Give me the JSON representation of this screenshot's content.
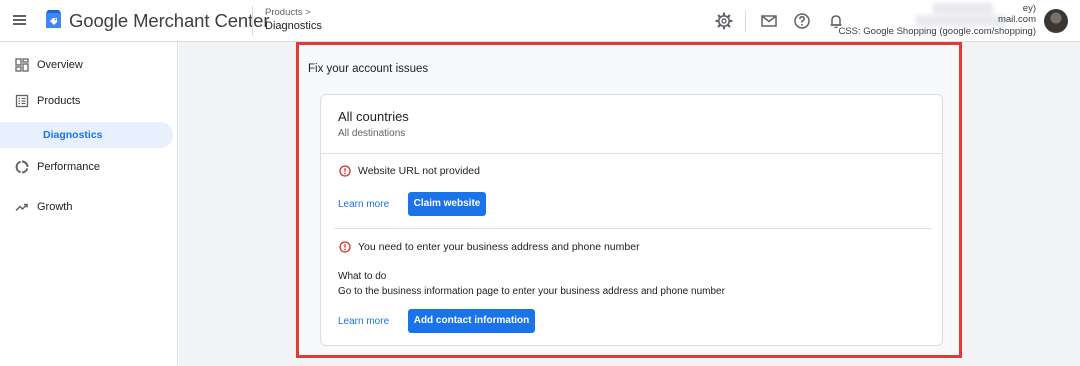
{
  "header": {
    "app_name": "Google Merchant Center",
    "breadcrumb_parent": "Products >",
    "breadcrumb_current": "Diagnostics",
    "account_name_suffix": "ey)",
    "account_email_suffix": "mail.com",
    "account_css": "CSS: Google Shopping (google.com/shopping)"
  },
  "sidebar": {
    "items": [
      {
        "label": "Overview",
        "icon": "dashboard-icon"
      },
      {
        "label": "Products",
        "icon": "list-icon"
      },
      {
        "label": "Diagnostics",
        "icon": ""
      },
      {
        "label": "Performance",
        "icon": "donut-chart-icon"
      },
      {
        "label": "Growth",
        "icon": "trending-up-icon"
      }
    ]
  },
  "main": {
    "panel_title": "Fix your account issues",
    "card": {
      "title": "All countries",
      "subtitle": "All destinations",
      "issues": [
        {
          "text": "Website URL not provided",
          "learn_more": "Learn more",
          "action": "Claim website"
        },
        {
          "text": "You need to enter your business address and phone number",
          "what_to_do_label": "What to do",
          "what_to_do_text": "Go to the business information page to enter your business address and phone number",
          "learn_more": "Learn more",
          "action": "Add contact information"
        }
      ]
    }
  },
  "colors": {
    "accent": "#1a73e8",
    "error": "#d93025",
    "highlight_border": "#e53935",
    "selected_nav_bg": "#e8f0fe"
  }
}
